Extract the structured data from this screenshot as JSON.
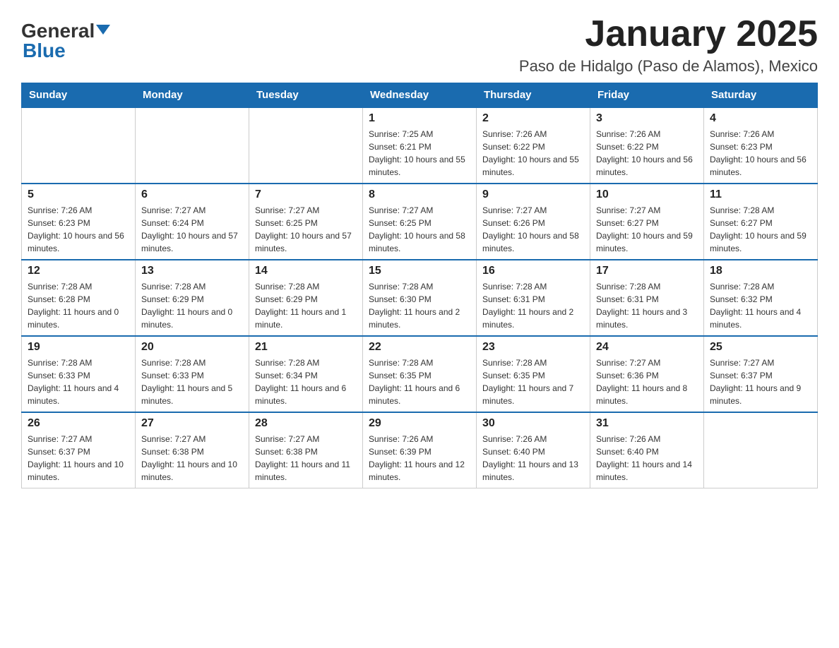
{
  "header": {
    "logo_general": "General",
    "logo_blue": "Blue",
    "month_title": "January 2025",
    "location": "Paso de Hidalgo (Paso de Alamos), Mexico"
  },
  "days_of_week": [
    "Sunday",
    "Monday",
    "Tuesday",
    "Wednesday",
    "Thursday",
    "Friday",
    "Saturday"
  ],
  "weeks": [
    [
      {
        "day": "",
        "info": ""
      },
      {
        "day": "",
        "info": ""
      },
      {
        "day": "",
        "info": ""
      },
      {
        "day": "1",
        "info": "Sunrise: 7:25 AM\nSunset: 6:21 PM\nDaylight: 10 hours and 55 minutes."
      },
      {
        "day": "2",
        "info": "Sunrise: 7:26 AM\nSunset: 6:22 PM\nDaylight: 10 hours and 55 minutes."
      },
      {
        "day": "3",
        "info": "Sunrise: 7:26 AM\nSunset: 6:22 PM\nDaylight: 10 hours and 56 minutes."
      },
      {
        "day": "4",
        "info": "Sunrise: 7:26 AM\nSunset: 6:23 PM\nDaylight: 10 hours and 56 minutes."
      }
    ],
    [
      {
        "day": "5",
        "info": "Sunrise: 7:26 AM\nSunset: 6:23 PM\nDaylight: 10 hours and 56 minutes."
      },
      {
        "day": "6",
        "info": "Sunrise: 7:27 AM\nSunset: 6:24 PM\nDaylight: 10 hours and 57 minutes."
      },
      {
        "day": "7",
        "info": "Sunrise: 7:27 AM\nSunset: 6:25 PM\nDaylight: 10 hours and 57 minutes."
      },
      {
        "day": "8",
        "info": "Sunrise: 7:27 AM\nSunset: 6:25 PM\nDaylight: 10 hours and 58 minutes."
      },
      {
        "day": "9",
        "info": "Sunrise: 7:27 AM\nSunset: 6:26 PM\nDaylight: 10 hours and 58 minutes."
      },
      {
        "day": "10",
        "info": "Sunrise: 7:27 AM\nSunset: 6:27 PM\nDaylight: 10 hours and 59 minutes."
      },
      {
        "day": "11",
        "info": "Sunrise: 7:28 AM\nSunset: 6:27 PM\nDaylight: 10 hours and 59 minutes."
      }
    ],
    [
      {
        "day": "12",
        "info": "Sunrise: 7:28 AM\nSunset: 6:28 PM\nDaylight: 11 hours and 0 minutes."
      },
      {
        "day": "13",
        "info": "Sunrise: 7:28 AM\nSunset: 6:29 PM\nDaylight: 11 hours and 0 minutes."
      },
      {
        "day": "14",
        "info": "Sunrise: 7:28 AM\nSunset: 6:29 PM\nDaylight: 11 hours and 1 minute."
      },
      {
        "day": "15",
        "info": "Sunrise: 7:28 AM\nSunset: 6:30 PM\nDaylight: 11 hours and 2 minutes."
      },
      {
        "day": "16",
        "info": "Sunrise: 7:28 AM\nSunset: 6:31 PM\nDaylight: 11 hours and 2 minutes."
      },
      {
        "day": "17",
        "info": "Sunrise: 7:28 AM\nSunset: 6:31 PM\nDaylight: 11 hours and 3 minutes."
      },
      {
        "day": "18",
        "info": "Sunrise: 7:28 AM\nSunset: 6:32 PM\nDaylight: 11 hours and 4 minutes."
      }
    ],
    [
      {
        "day": "19",
        "info": "Sunrise: 7:28 AM\nSunset: 6:33 PM\nDaylight: 11 hours and 4 minutes."
      },
      {
        "day": "20",
        "info": "Sunrise: 7:28 AM\nSunset: 6:33 PM\nDaylight: 11 hours and 5 minutes."
      },
      {
        "day": "21",
        "info": "Sunrise: 7:28 AM\nSunset: 6:34 PM\nDaylight: 11 hours and 6 minutes."
      },
      {
        "day": "22",
        "info": "Sunrise: 7:28 AM\nSunset: 6:35 PM\nDaylight: 11 hours and 6 minutes."
      },
      {
        "day": "23",
        "info": "Sunrise: 7:28 AM\nSunset: 6:35 PM\nDaylight: 11 hours and 7 minutes."
      },
      {
        "day": "24",
        "info": "Sunrise: 7:27 AM\nSunset: 6:36 PM\nDaylight: 11 hours and 8 minutes."
      },
      {
        "day": "25",
        "info": "Sunrise: 7:27 AM\nSunset: 6:37 PM\nDaylight: 11 hours and 9 minutes."
      }
    ],
    [
      {
        "day": "26",
        "info": "Sunrise: 7:27 AM\nSunset: 6:37 PM\nDaylight: 11 hours and 10 minutes."
      },
      {
        "day": "27",
        "info": "Sunrise: 7:27 AM\nSunset: 6:38 PM\nDaylight: 11 hours and 10 minutes."
      },
      {
        "day": "28",
        "info": "Sunrise: 7:27 AM\nSunset: 6:38 PM\nDaylight: 11 hours and 11 minutes."
      },
      {
        "day": "29",
        "info": "Sunrise: 7:26 AM\nSunset: 6:39 PM\nDaylight: 11 hours and 12 minutes."
      },
      {
        "day": "30",
        "info": "Sunrise: 7:26 AM\nSunset: 6:40 PM\nDaylight: 11 hours and 13 minutes."
      },
      {
        "day": "31",
        "info": "Sunrise: 7:26 AM\nSunset: 6:40 PM\nDaylight: 11 hours and 14 minutes."
      },
      {
        "day": "",
        "info": ""
      }
    ]
  ]
}
